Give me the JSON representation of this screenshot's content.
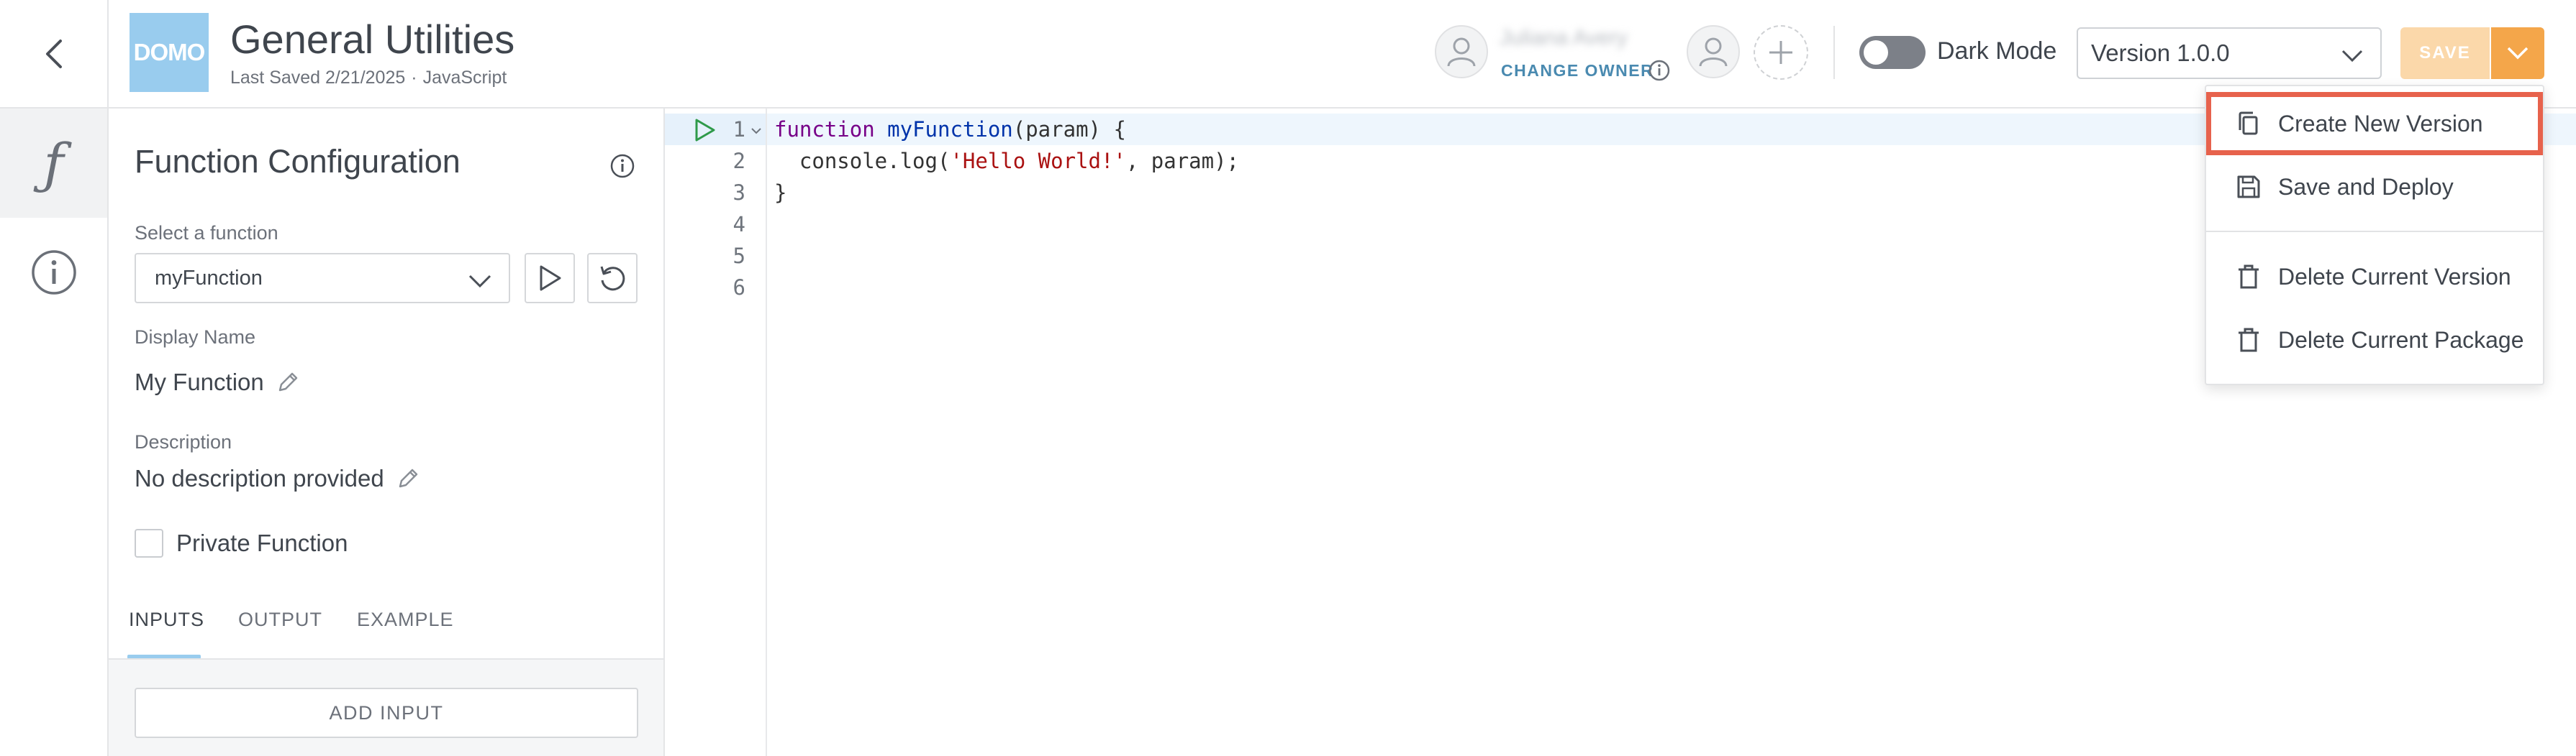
{
  "header": {
    "logo_text": "DOMO",
    "title": "General Utilities",
    "last_saved": "Last Saved 2/21/2025",
    "separator": "·",
    "language": "JavaScript",
    "owner_name": "Juliana Avery",
    "change_owner_label": "CHANGE OWNER",
    "dark_mode_label": "Dark Mode",
    "dark_mode_on": false,
    "version_value": "Version 1.0.0",
    "save_label": "SAVE"
  },
  "panel": {
    "title": "Function Configuration",
    "select_label": "Select a function",
    "selected_function": "myFunction",
    "display_name_label": "Display Name",
    "display_name": "My Function",
    "description_label": "Description",
    "description": "No description provided",
    "private_label": "Private Function",
    "private_checked": false,
    "tabs": [
      "INPUTS",
      "OUTPUT",
      "EXAMPLE"
    ],
    "active_tab": "INPUTS",
    "add_input_label": "ADD INPUT"
  },
  "editor": {
    "line_numbers": [
      "1",
      "2",
      "3",
      "4",
      "5",
      "6"
    ],
    "code": {
      "l1_kw": "function",
      "l1_name": "myFunction",
      "l1_param": "(param) {",
      "l2_a": "  console.log(",
      "l2_str": "'Hello World!'",
      "l2_b": ", param);",
      "l3": "}"
    }
  },
  "menu": {
    "items": [
      {
        "label": "Create New Version",
        "icon": "copy-icon"
      },
      {
        "label": "Save and Deploy",
        "icon": "floppy-icon"
      },
      {
        "label": "Delete Current Version",
        "icon": "trash-icon"
      },
      {
        "label": "Delete Current Package",
        "icon": "trash-icon"
      }
    ]
  },
  "colors": {
    "accent_orange": "#f4a64a",
    "save_disabled": "#fbd8aa",
    "highlight_outline": "#e7624c",
    "logo_blue": "#99ccee",
    "link_blue": "#4a8ab0"
  }
}
